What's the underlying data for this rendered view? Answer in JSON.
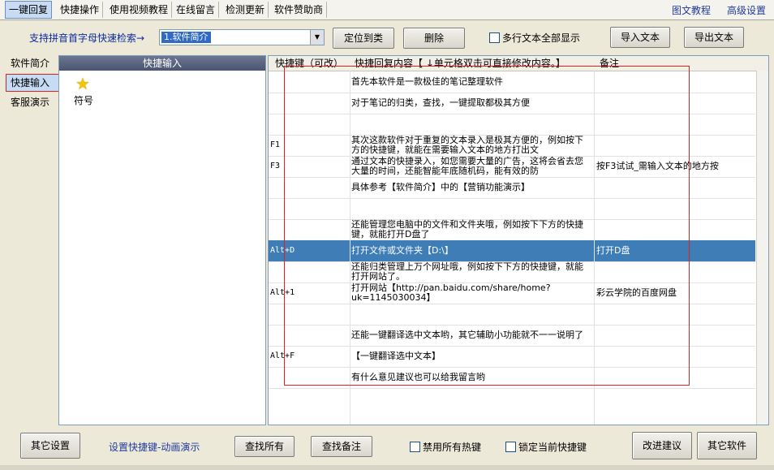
{
  "tabs": [
    "一键回复",
    "快捷操作",
    "使用视频教程",
    "在线留言",
    "检测更新",
    "软件赞助商"
  ],
  "top_links": [
    "图文教程",
    "高级设置"
  ],
  "search": {
    "label": "支持拼音首字母快速检索→",
    "value": "1.软件简介"
  },
  "toolbar": {
    "locate": "定位到类",
    "delete": "删除",
    "multiline_check": "多行文本全部显示",
    "import": "导入文本",
    "export": "导出文本"
  },
  "nav": [
    "软件简介",
    "快捷输入",
    "客服演示"
  ],
  "mid_panel": {
    "header": "快捷输入",
    "item_label": "符号",
    "item_icon": "star-icon"
  },
  "table": {
    "headers": [
      "快捷键（可改）",
      "快捷回复内容【 ↓单元格双击可直接修改内容。】",
      "备注"
    ],
    "rows": [
      {
        "key": "",
        "content": "首先本软件是一款极佳的笔记整理软件",
        "note": ""
      },
      {
        "key": "",
        "content": "对于笔记的归类，查找，一键提取都极其方便",
        "note": ""
      },
      {
        "key": "",
        "content": "",
        "note": ""
      },
      {
        "key": "F1",
        "content": "其次这款软件对于重复的文本录入是极其方便的，例如按下方的快捷键，就能在需要输入文本的地方打出文",
        "note": ""
      },
      {
        "key": "F3",
        "content": "通过文本的快捷录入，如您需要大量的广告，这将会省去您大量的时间，还能智能年底随机码，能有效的防",
        "note": "按F3试试_需输入文本的地方按"
      },
      {
        "key": "",
        "content": "具体参考【软件简介】中的【营销功能演示】",
        "note": ""
      },
      {
        "key": "",
        "content": "",
        "note": ""
      },
      {
        "key": "",
        "content": "还能管理您电脑中的文件和文件夹哦，例如按下下方的快捷键，就能打开D盘了",
        "note": ""
      },
      {
        "key": "Alt+D",
        "content": "打开文件或文件夹【D:\\】",
        "note": "打开D盘"
      },
      {
        "key": "",
        "content": "还能归类管理上万个网址哦，例如按下下方的快捷键，就能打开网站了。",
        "note": ""
      },
      {
        "key": "Alt+1",
        "content": "打开网站【http://pan.baidu.com/share/home?uk=1145030034】",
        "note": "彩云学院的百度网盘"
      },
      {
        "key": "",
        "content": "",
        "note": ""
      },
      {
        "key": "",
        "content": "还能一键翻译选中文本哟，其它辅助小功能就不一一说明了",
        "note": ""
      },
      {
        "key": "Alt+F",
        "content": "【一键翻译选中文本】",
        "note": ""
      },
      {
        "key": "",
        "content": "有什么意见建议也可以给我留言哟",
        "note": ""
      }
    ],
    "selected_row": 8
  },
  "bottom": {
    "other_settings": "其它设置",
    "hotkey_demo": "设置快捷键-动画演示",
    "find_all": "查找所有",
    "find_notes": "查找备注",
    "disable_hotkeys": "禁用所有热键",
    "lock_hotkey": "锁定当前快捷键",
    "suggest": "改进建议",
    "other_software": "其它软件"
  }
}
